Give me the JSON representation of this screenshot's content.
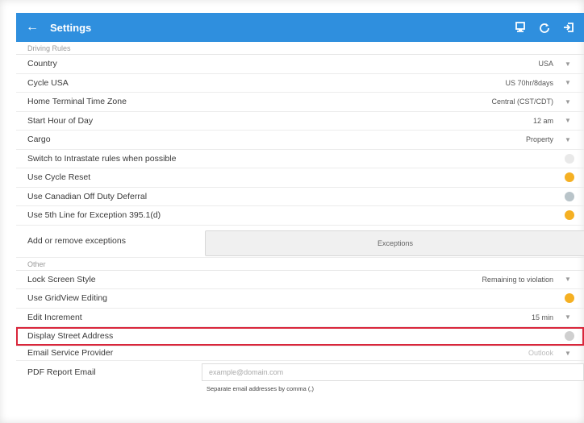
{
  "appbar": {
    "title": "Settings",
    "back_icon": "arrow-back-icon",
    "bg": "#2f8fde"
  },
  "sections": {
    "driving_rules": "Driving Rules",
    "other": "Other"
  },
  "rows": {
    "country": {
      "label": "Country",
      "value": "USA"
    },
    "cycle": {
      "label": "Cycle USA",
      "value": "US 70hr/8days"
    },
    "time_zone": {
      "label": "Home Terminal Time Zone",
      "value": "Central (CST/CDT)"
    },
    "start_hour": {
      "label": "Start Hour of Day",
      "value": "12 am"
    },
    "cargo": {
      "label": "Cargo",
      "value": "Property"
    },
    "intrastate": {
      "label": "Switch to Intrastate rules when possible"
    },
    "cycle_reset": {
      "label": "Use Cycle Reset"
    },
    "canadian_off": {
      "label": "Use Canadian Off Duty Deferral"
    },
    "sixth_line": {
      "label": "Use 5th Line for Exception 395.1(d)"
    },
    "exceptions": {
      "label": "Add or remove exceptions",
      "button": "Exceptions"
    },
    "lock_screen": {
      "label": "Lock Screen Style",
      "value": "Remaining to violation"
    },
    "gridview": {
      "label": "Use GridView Editing"
    },
    "edit_increment": {
      "label": "Edit Increment",
      "value": "15 min"
    },
    "street_address": {
      "label": "Display Street Address"
    },
    "email_provider": {
      "label": "Email Service Provider",
      "value": "Outlook"
    },
    "pdf_email": {
      "label": "PDF Report Email",
      "placeholder": "example@domain.com",
      "hint": "Separate email addresses by comma (,)"
    }
  },
  "colors": {
    "accent": "#f5b023",
    "highlight": "#d9263b"
  }
}
